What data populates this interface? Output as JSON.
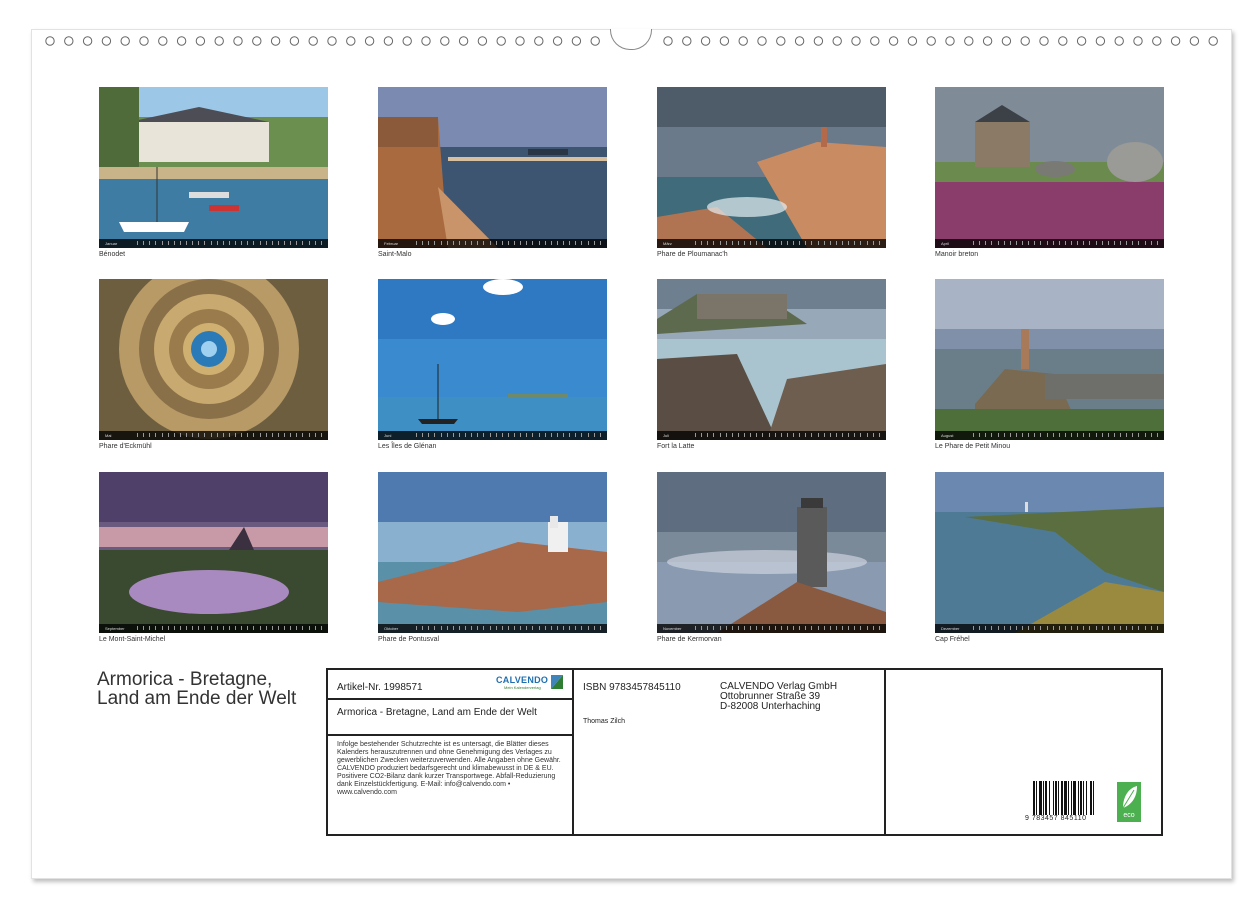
{
  "calendar": {
    "title": "Armorica - Bretagne, Land am Ende der Welt",
    "months": [
      {
        "month": "Januar",
        "caption": "Bénodet"
      },
      {
        "month": "Februar",
        "caption": "Saint-Malo"
      },
      {
        "month": "März",
        "caption": "Phare de Ploumanac'h"
      },
      {
        "month": "April",
        "caption": "Manoir breton"
      },
      {
        "month": "Mai",
        "caption": "Phare d'Eckmühl"
      },
      {
        "month": "Juni",
        "caption": "Les Îles de Glénan"
      },
      {
        "month": "Juli",
        "caption": "Fort la Latte"
      },
      {
        "month": "August",
        "caption": "Le Phare de Petit Minou"
      },
      {
        "month": "September",
        "caption": "Le Mont-Saint-Michel"
      },
      {
        "month": "Oktober",
        "caption": "Phare de Pontusval"
      },
      {
        "month": "November",
        "caption": "Phare de Kermorvan"
      },
      {
        "month": "Dezember",
        "caption": "Cap Fréhel"
      }
    ]
  },
  "info": {
    "article": "Artikel-Nr. 1998571",
    "brand": "CALVENDO",
    "brand_sub": "Mein Kalenderverlag",
    "product_title": "Armorica - Bretagne, Land am Ende der Welt",
    "legal": "Infolge bestehender Schutzrechte ist es untersagt, die Blätter dieses Kalenders herauszutrennen und ohne Genehmigung des Verlages zu gewerblichen Zwecken weiterzuverwenden. Alle Angaben ohne Gewähr. CALVENDO produziert bedarfsgerecht und klimabewusst in DE & EU. Positivere CO2-Bilanz dank kurzer Transportwege. Abfall-Reduzierung dank Einzelstückfertigung. E-Mail: info@calvendo.com • www.calvendo.com",
    "isbn": "ISBN 9783457845110",
    "author": "Thomas Zilch",
    "publisher_name": "CALVENDO Verlag GmbH",
    "publisher_street": "Ottobrunner Straße 39",
    "publisher_city": "D-82008 Unterhaching",
    "barcode_digits": "9 783457 845110",
    "eco_label": "eco"
  },
  "colors": {
    "border": "#222222",
    "brand_green": "#2e7d32",
    "brand_blue": "#1e6fb0"
  }
}
